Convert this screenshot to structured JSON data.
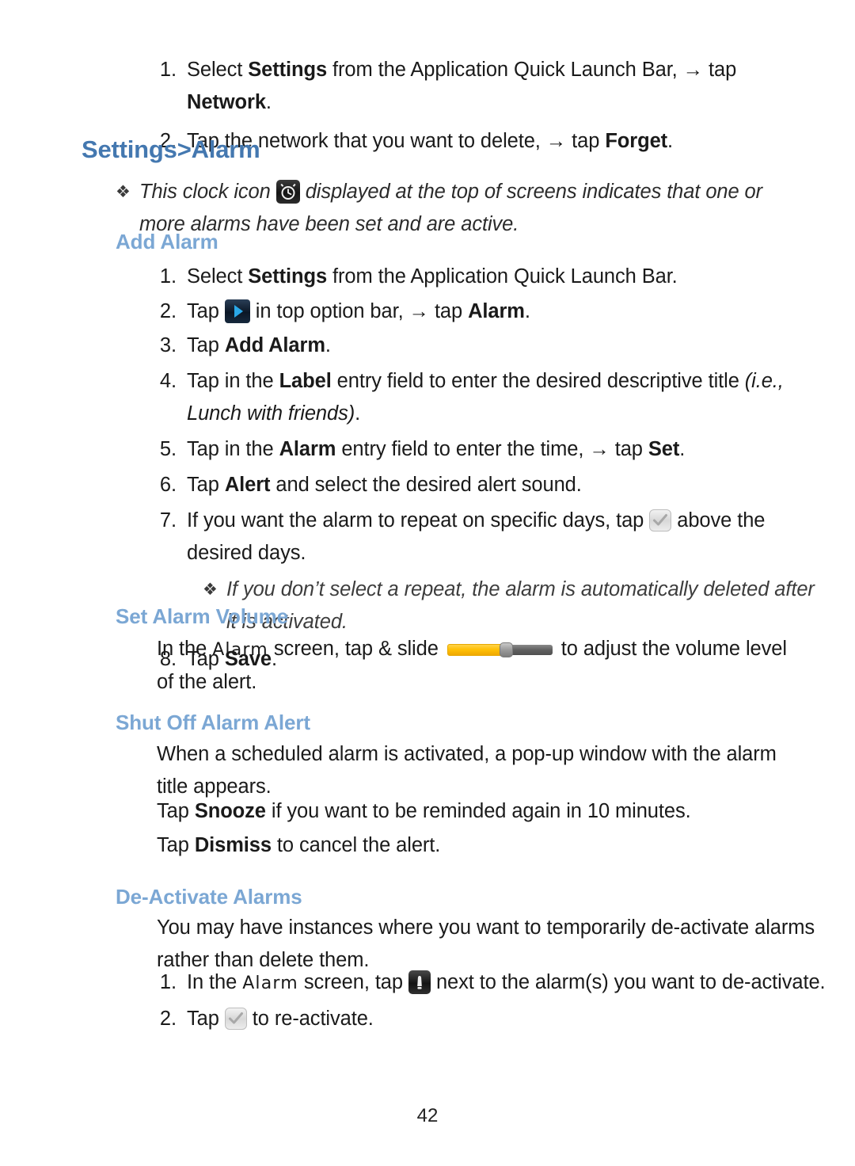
{
  "document": {
    "page_number": "42",
    "colors": {
      "heading_primary": "#4478b0",
      "heading_secondary": "#7ba7d4",
      "body_text": "#1a1a1a",
      "slider_fill": "#ffc107",
      "slider_track": "#606060"
    }
  },
  "top_steps": {
    "item1": {
      "number": "1.",
      "part1": "Select ",
      "bold1": "Settings",
      "part2": " from the Application Quick Launch Bar, ",
      "arrow": "→",
      "part3": " tap ",
      "bold2": "Network",
      "part4": "."
    },
    "item2": {
      "number": "2.",
      "part1": "Tap the network that you want to delete, ",
      "arrow": "→",
      "part2": " tap ",
      "bold1": "Forget",
      "part3": "."
    }
  },
  "main_heading": "Settings>Alarm",
  "clock_note": {
    "bullet": "❖",
    "part1": "This clock icon ",
    "icon_name": "alarm-clock-icon",
    "part2": " displayed at the top of screens indicates that one or more alarms have been set and are active."
  },
  "add_alarm": {
    "heading": "Add Alarm",
    "steps": {
      "s1": {
        "number": "1.",
        "part1": "Select ",
        "bold1": "Settings",
        "part2": " from the Application Quick Launch Bar."
      },
      "s2": {
        "number": "2.",
        "part1": "Tap ",
        "icon_name": "top-option-bar-arrow-icon",
        "part2": " in top option bar, ",
        "arrow": "→",
        "part3": " tap ",
        "bold1": "Alarm",
        "part4": "."
      },
      "s3": {
        "number": "3.",
        "part1": "Tap ",
        "bold1": "Add Alarm",
        "part2": "."
      },
      "s4": {
        "number": "4.",
        "part1": "Tap in the ",
        "bold1": "Label",
        "part2": " entry field to enter the desired descriptive title ",
        "italic1": "(i.e., Lunch with friends)",
        "part3": "."
      },
      "s5": {
        "number": "5.",
        "part1": "Tap in the ",
        "bold1": "Alarm",
        "part2": " entry field to enter the time, ",
        "arrow": "→",
        "part3": " tap ",
        "bold2": "Set",
        "part4": "."
      },
      "s6": {
        "number": "6.",
        "part1": "Tap ",
        "bold1": "Alert",
        "part2": " and select the desired alert sound."
      },
      "s7": {
        "number": "7.",
        "part1": "If you want the alarm to repeat on specific days, tap ",
        "icon_name": "repeat-checkbox-icon",
        "part2": " above the desired days."
      },
      "s7_note": {
        "bullet": "❖",
        "text": "If you don’t select a repeat, the alarm is automatically deleted after it is activated."
      },
      "s8": {
        "number": "8.",
        "part1": "Tap ",
        "bold1": "Save",
        "part2": "."
      }
    }
  },
  "set_alarm_volume": {
    "heading": "Set Alarm Volume",
    "part1": "In the ",
    "screen_name": "Alarm",
    "part2": " screen, tap & slide ",
    "slider_name": "volume-slider",
    "part3": " to adjust the volume level of the alert."
  },
  "shut_off_alarm_alert": {
    "heading": "Shut Off Alarm Alert",
    "paragraph1": "When a scheduled alarm is activated, a pop-up window with the alarm title appears.",
    "paragraph2": {
      "part1": "Tap ",
      "bold1": "Snooze",
      "part2": " if you want to be reminded again in 10 minutes."
    },
    "paragraph3": {
      "part1": "Tap ",
      "bold1": "Dismiss",
      "part2": " to cancel the alert."
    }
  },
  "de_activate_alarms": {
    "heading": "De-Activate Alarms",
    "paragraph1": "You may have instances where you want to temporarily de-activate alarms rather than delete them.",
    "steps": {
      "s1": {
        "number": "1.",
        "part1": "In the ",
        "screen_name": "Alarm",
        "part2": " screen, tap ",
        "icon_name": "alarm-off-bell-icon",
        "part3": " next to the alarm(s) you want to de-activate."
      },
      "s2": {
        "number": "2.",
        "part1": "Tap ",
        "icon_name": "reactivate-checkbox-icon",
        "part2": " to re-activate."
      }
    }
  }
}
